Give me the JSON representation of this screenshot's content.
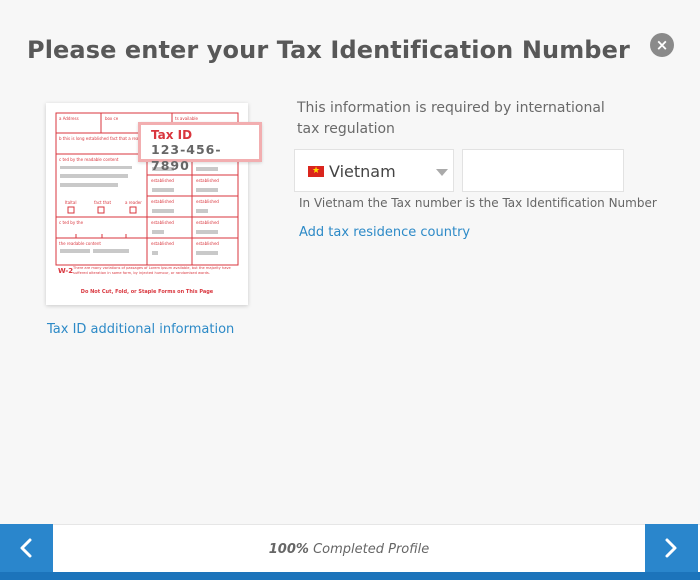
{
  "modal": {
    "title": "Please enter your Tax Identification Number",
    "close_glyph": "×"
  },
  "form_illustration": {
    "icon": "w2-tax-form-icon",
    "field_top_left": "a Address",
    "field_top_mid": "box ce",
    "field_top_right": "ts available",
    "field_line2": "b this is long established fact that a reader",
    "field_line3": "c  ted by the readable content",
    "cb_label_1": "ItaltaI",
    "cb_label_2": "fact that",
    "cb_label_3": "a reader",
    "field_long": "c  ted by the",
    "field_bottom": "the readable content",
    "available_label": "established",
    "form_code": "W-2",
    "fine_print": "There are many variations of passages of Lorem Ipsum available, but the majority have suffered alteration in some form, by injected humour, or randomised words.",
    "footer_note": "Do Not Cut, Fold, or Staple Forms on This Page",
    "callout_label": "Tax ID",
    "callout_number": "123-456-7890",
    "border_color": "#d9363e"
  },
  "info_link": "Tax ID additional information",
  "description": "This information is required by international tax regulation",
  "country": {
    "selected": "Vietnam",
    "flag_icon": "vietnam-flag-icon",
    "flag_color": "#da251d",
    "star_color": "#ffde00",
    "star_glyph": "★"
  },
  "tax_number": {
    "value": "",
    "placeholder": ""
  },
  "hint": "In Vietnam the Tax number is the Tax Identification Number",
  "add_residence_link": "Add tax residence country",
  "footer": {
    "progress_percent": "100%",
    "progress_label": "Completed Profile",
    "progress_fraction": 1.0,
    "accent_color": "#2a86cc"
  }
}
